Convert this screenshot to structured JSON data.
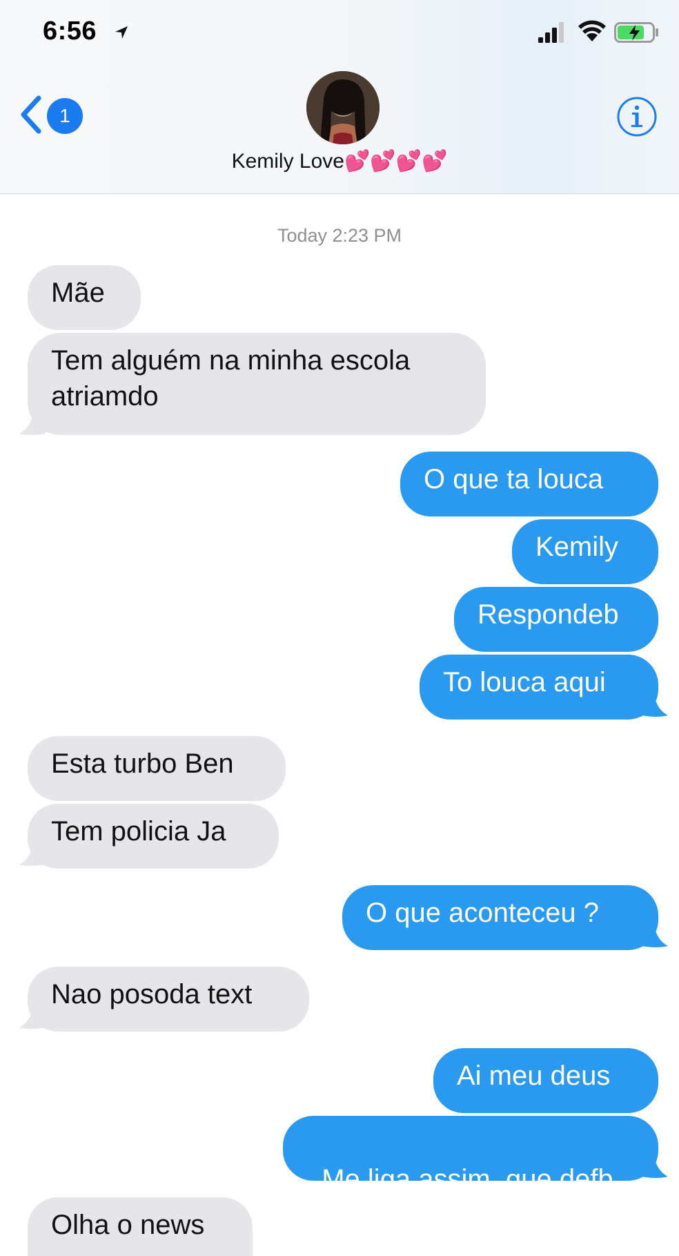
{
  "status_bar": {
    "time": "6:56"
  },
  "header": {
    "back_badge": "1",
    "contact_name": "Kemily Love💕💕💕💕"
  },
  "conversation": {
    "timestamp": "Today 2:23 PM",
    "messages": [
      {
        "from": "contact",
        "text": "Mãe"
      },
      {
        "from": "contact",
        "text_lines": [
          "Tem alguém na minha escola",
          "atriamdo"
        ]
      },
      {
        "from": "me",
        "text": "O que ta louca"
      },
      {
        "from": "me",
        "text": "Kemily"
      },
      {
        "from": "me",
        "text": "Respondeb"
      },
      {
        "from": "me",
        "text": "To louca aqui"
      },
      {
        "from": "contact",
        "text": "Esta turbo Ben"
      },
      {
        "from": "contact",
        "text": "Tem policia Ja"
      },
      {
        "from": "me",
        "text": "O que aconteceu ?"
      },
      {
        "from": "contact",
        "text": "Nao posoda text"
      },
      {
        "from": "me",
        "text": "Ai meu deus"
      },
      {
        "from": "me",
        "text": "Me liga assim  que defb"
      },
      {
        "from": "contact",
        "text": "Olha o news"
      }
    ]
  },
  "colors": {
    "sent_bubble": "#2a9af0",
    "received_bubble": "#e5e5ea",
    "accent": "#1a7cf0"
  },
  "icons": [
    "location-arrow-icon",
    "signal-bars-icon",
    "wifi-icon",
    "battery-charging-icon",
    "back-chevron-icon",
    "info-icon"
  ]
}
